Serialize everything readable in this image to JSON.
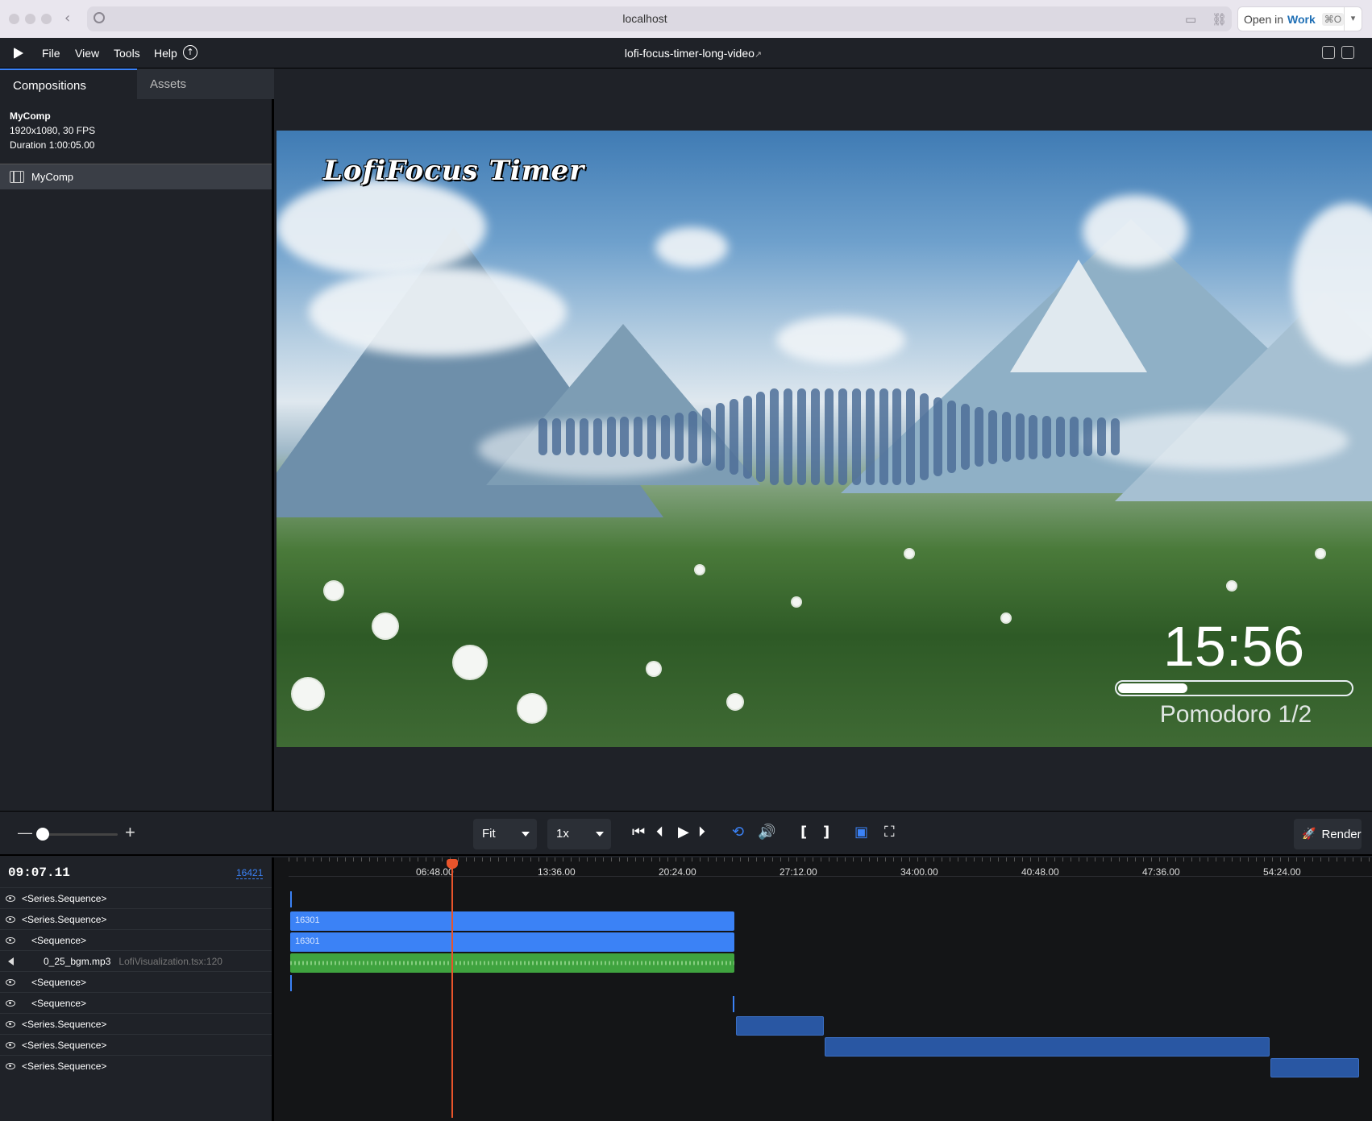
{
  "browser": {
    "url": "localhost",
    "open_in_label": "Open in",
    "open_in_target": "Work",
    "open_in_shortcut": "⌘O"
  },
  "menubar": {
    "items": [
      "File",
      "View",
      "Tools",
      "Help"
    ],
    "project_title": "lofi-focus-timer-long-video",
    "project_link_icon": "↗"
  },
  "sidebar": {
    "tabs": [
      "Compositions",
      "Assets"
    ],
    "active_tab": "Compositions",
    "comp_info": {
      "name": "MyComp",
      "resolution": "1920x1080, 30 FPS",
      "duration": "Duration 1:00:05.00"
    },
    "compositions": [
      "MyComp"
    ]
  },
  "preview": {
    "title": "LofiFocus Timer",
    "timer": "15:56",
    "timer_progress": 0.3,
    "pomodoro": "Pomodoro 1/2",
    "equalizer_levels": [
      0.38,
      0.38,
      0.38,
      0.38,
      0.38,
      0.42,
      0.42,
      0.42,
      0.46,
      0.46,
      0.5,
      0.54,
      0.6,
      0.7,
      0.78,
      0.86,
      0.93,
      1.0,
      1.0,
      1.0,
      1.0,
      1.0,
      1.0,
      1.0,
      1.0,
      1.0,
      1.0,
      1.0,
      0.9,
      0.82,
      0.75,
      0.68,
      0.62,
      0.56,
      0.52,
      0.48,
      0.46,
      0.44,
      0.42,
      0.42,
      0.4,
      0.4,
      0.38
    ]
  },
  "controls": {
    "fit": "Fit",
    "speed": "1x",
    "render": "Render",
    "icons": [
      "skip-to-start-icon",
      "step-back-icon",
      "play-icon",
      "step-forward-icon",
      "loop-icon",
      "volume-icon",
      "in-point-icon",
      "out-point-icon",
      "checkerboard-icon",
      "fullscreen-icon"
    ],
    "accent_color": "#3b82f6"
  },
  "timeline": {
    "timecode": "09:07.11",
    "frame": "16421",
    "ticks": [
      "06:48.00",
      "13:36.00",
      "20:24.00",
      "27:12.00",
      "34:00.00",
      "40:48.00",
      "47:36.00",
      "54:24.00"
    ],
    "tracks": [
      {
        "label": "<Series.Sequence>",
        "indent": 0,
        "icon": "eye"
      },
      {
        "label": "<Series.Sequence>",
        "indent": 0,
        "icon": "eye"
      },
      {
        "label": "<Sequence>",
        "indent": 1,
        "icon": "eye"
      },
      {
        "label": "0_25_bgm.mp3",
        "sub": "LofiVisualization.tsx:120",
        "indent": 2,
        "icon": "speaker"
      },
      {
        "label": "<Sequence>",
        "indent": 1,
        "icon": "eye"
      },
      {
        "label": "<Sequence>",
        "indent": 1,
        "icon": "eye"
      },
      {
        "label": "<Series.Sequence>",
        "indent": 0,
        "icon": "eye"
      },
      {
        "label": "<Series.Sequence>",
        "indent": 0,
        "icon": "eye"
      },
      {
        "label": "<Series.Sequence>",
        "indent": 0,
        "icon": "eye"
      }
    ],
    "clip_labels": [
      "16301",
      "16301"
    ],
    "playhead_color": "#e8542b"
  }
}
